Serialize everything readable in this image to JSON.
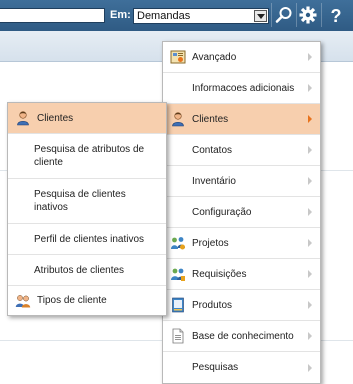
{
  "toolbar": {
    "search_value": "",
    "scope_label": "Em:",
    "scope_value": "Demandas",
    "icons": [
      "search-icon",
      "gear-icon",
      "help-icon"
    ]
  },
  "main_menu": {
    "items": [
      {
        "label": "Avançado",
        "icon": "advanced-icon",
        "has_arrow": true
      },
      {
        "label": "Informacoes adicionais",
        "icon": "",
        "has_arrow": true
      },
      {
        "label": "Clientes",
        "icon": "client-icon",
        "has_arrow": true,
        "active": true
      },
      {
        "label": "Contatos",
        "icon": "",
        "has_arrow": true
      },
      {
        "label": "Inventário",
        "icon": "",
        "has_arrow": true
      },
      {
        "label": "Configuração",
        "icon": "",
        "has_arrow": true
      },
      {
        "label": "Projetos",
        "icon": "projects-icon",
        "has_arrow": true
      },
      {
        "label": "Requisições",
        "icon": "requests-icon",
        "has_arrow": true
      },
      {
        "label": "Produtos",
        "icon": "products-icon",
        "has_arrow": true
      },
      {
        "label": "Base de conhecimento",
        "icon": "knowledge-base-icon",
        "has_arrow": true
      },
      {
        "label": "Pesquisas",
        "icon": "",
        "has_arrow": true
      }
    ]
  },
  "sub_menu": {
    "items": [
      {
        "label": "Clientes",
        "icon": "client-icon",
        "active": true
      },
      {
        "label": "Pesquisa de atributos de cliente",
        "icon": ""
      },
      {
        "label": "Pesquisa de clientes inativos",
        "icon": ""
      },
      {
        "label": "Perfil de clientes inativos",
        "icon": ""
      },
      {
        "label": "Atributos de clientes",
        "icon": ""
      },
      {
        "label": "Tipos de cliente",
        "icon": "client-types-icon"
      }
    ]
  },
  "colors": {
    "toolbar_bg": "#2f5b84",
    "active_item_bg": "#f7cfae",
    "active_arrow": "#e8731c"
  }
}
